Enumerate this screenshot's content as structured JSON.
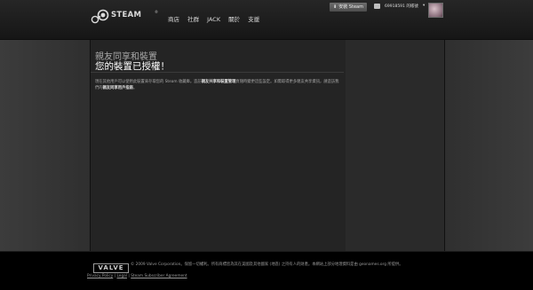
{
  "header": {
    "logo_text": "STEAM",
    "logo_tm": "®",
    "nav": [
      "商店",
      "社群",
      "JACK",
      "關於",
      "支援"
    ],
    "install_label": "安裝 Steam",
    "account_name": "69918591 的帳號",
    "account_caret": "▾"
  },
  "main": {
    "heading": "親友同享和裝置",
    "title": "您的裝置已授權！",
    "paragraph": [
      "現在其他用戶可以使用此裝置來存取您的 Steam 收藏庫。造訪",
      "親友共享和裝置管理",
      "頁隨時變更這些設定。如需取得更多親友共享資訊，請造訪我們的",
      "親友同享用戶指南",
      "。"
    ]
  },
  "footer": {
    "valve_logo": "VALVE",
    "copyright": "© 2009 Valve Corporation。保留一切權利。所有商標皆為其在美國及其他國家 (地區) 之持有人的財產。本網站上部分地理資料是由 geonames.org 所提供。",
    "links": [
      "Privacy Policy",
      "Legal",
      "Steam Subscriber Agreement"
    ],
    "separator": " | "
  }
}
